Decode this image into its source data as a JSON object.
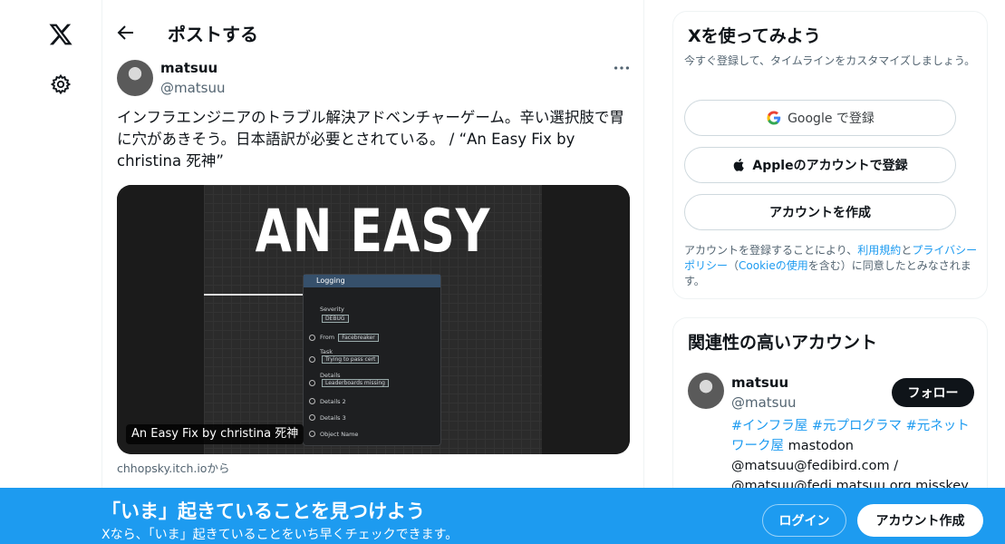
{
  "nav": {
    "logo_icon": "x-logo-icon",
    "settings_icon": "gear-icon"
  },
  "header": {
    "title": "ポストする",
    "back_icon": "arrow-left-icon"
  },
  "post": {
    "author_name": "matsuu",
    "author_handle": "@matsuu",
    "more_icon": "more-horizontal-icon",
    "text": "インフラエンジニアのトラブル解決アドベンチャーゲーム。辛い選択肢で胃に穴があきそう。日本語訳が必要とされている。 / “An Easy Fix by christina 死神”",
    "card": {
      "headline": "AN EASY FIX",
      "caption": "An Easy Fix by christina 死神",
      "domain": "chhopsky.itch.ioから",
      "node": {
        "title": "Logging",
        "severity_label": "Severity",
        "severity_value": "DEBUG",
        "from_label": "From",
        "from_value": "Facebreaker",
        "task_label": "Task",
        "task_value": "Trying to pass cert",
        "details_label": "Details",
        "details_value": "Leaderboards missing",
        "details2_label": "Details 2",
        "details3_label": "Details 3",
        "object_label": "Object Name"
      }
    }
  },
  "signup_panel": {
    "title": "Xを使ってみよう",
    "subtitle": "今すぐ登録して、タイムラインをカスタマイズしましょう。",
    "google_label": "Google で登録",
    "apple_label": "Appleのアカウントで登録",
    "create_label": "アカウントを作成",
    "legal_prefix": "アカウントを登録することにより、",
    "legal_terms": "利用規約",
    "legal_and": "と",
    "legal_privacy": "プライバシーポリシー",
    "legal_paren_open": "（",
    "legal_cookie": "Cookieの使用",
    "legal_suffix": "を含む）に同意したとみなされます。"
  },
  "related_panel": {
    "title": "関連性の高いアカウント",
    "name": "matsuu",
    "handle": "@matsuu",
    "follow_label": "フォロー",
    "bio_tags": "#インフラ屋 #元プログラマ #元ネットワーク屋",
    "bio_rest": " mastodon @matsuu@fedibird.com / @matsuu@fedi.matsuu.org misskey"
  },
  "banner": {
    "title": "「いま」起きていることを見つけよう",
    "subtitle": "Xなら、「いま」起きていることをいち早くチェックできます。",
    "login_label": "ログイン",
    "signup_label": "アカウント作成"
  },
  "colors": {
    "accent": "#1d9bf0",
    "text": "#0f1419",
    "muted": "#536471"
  }
}
